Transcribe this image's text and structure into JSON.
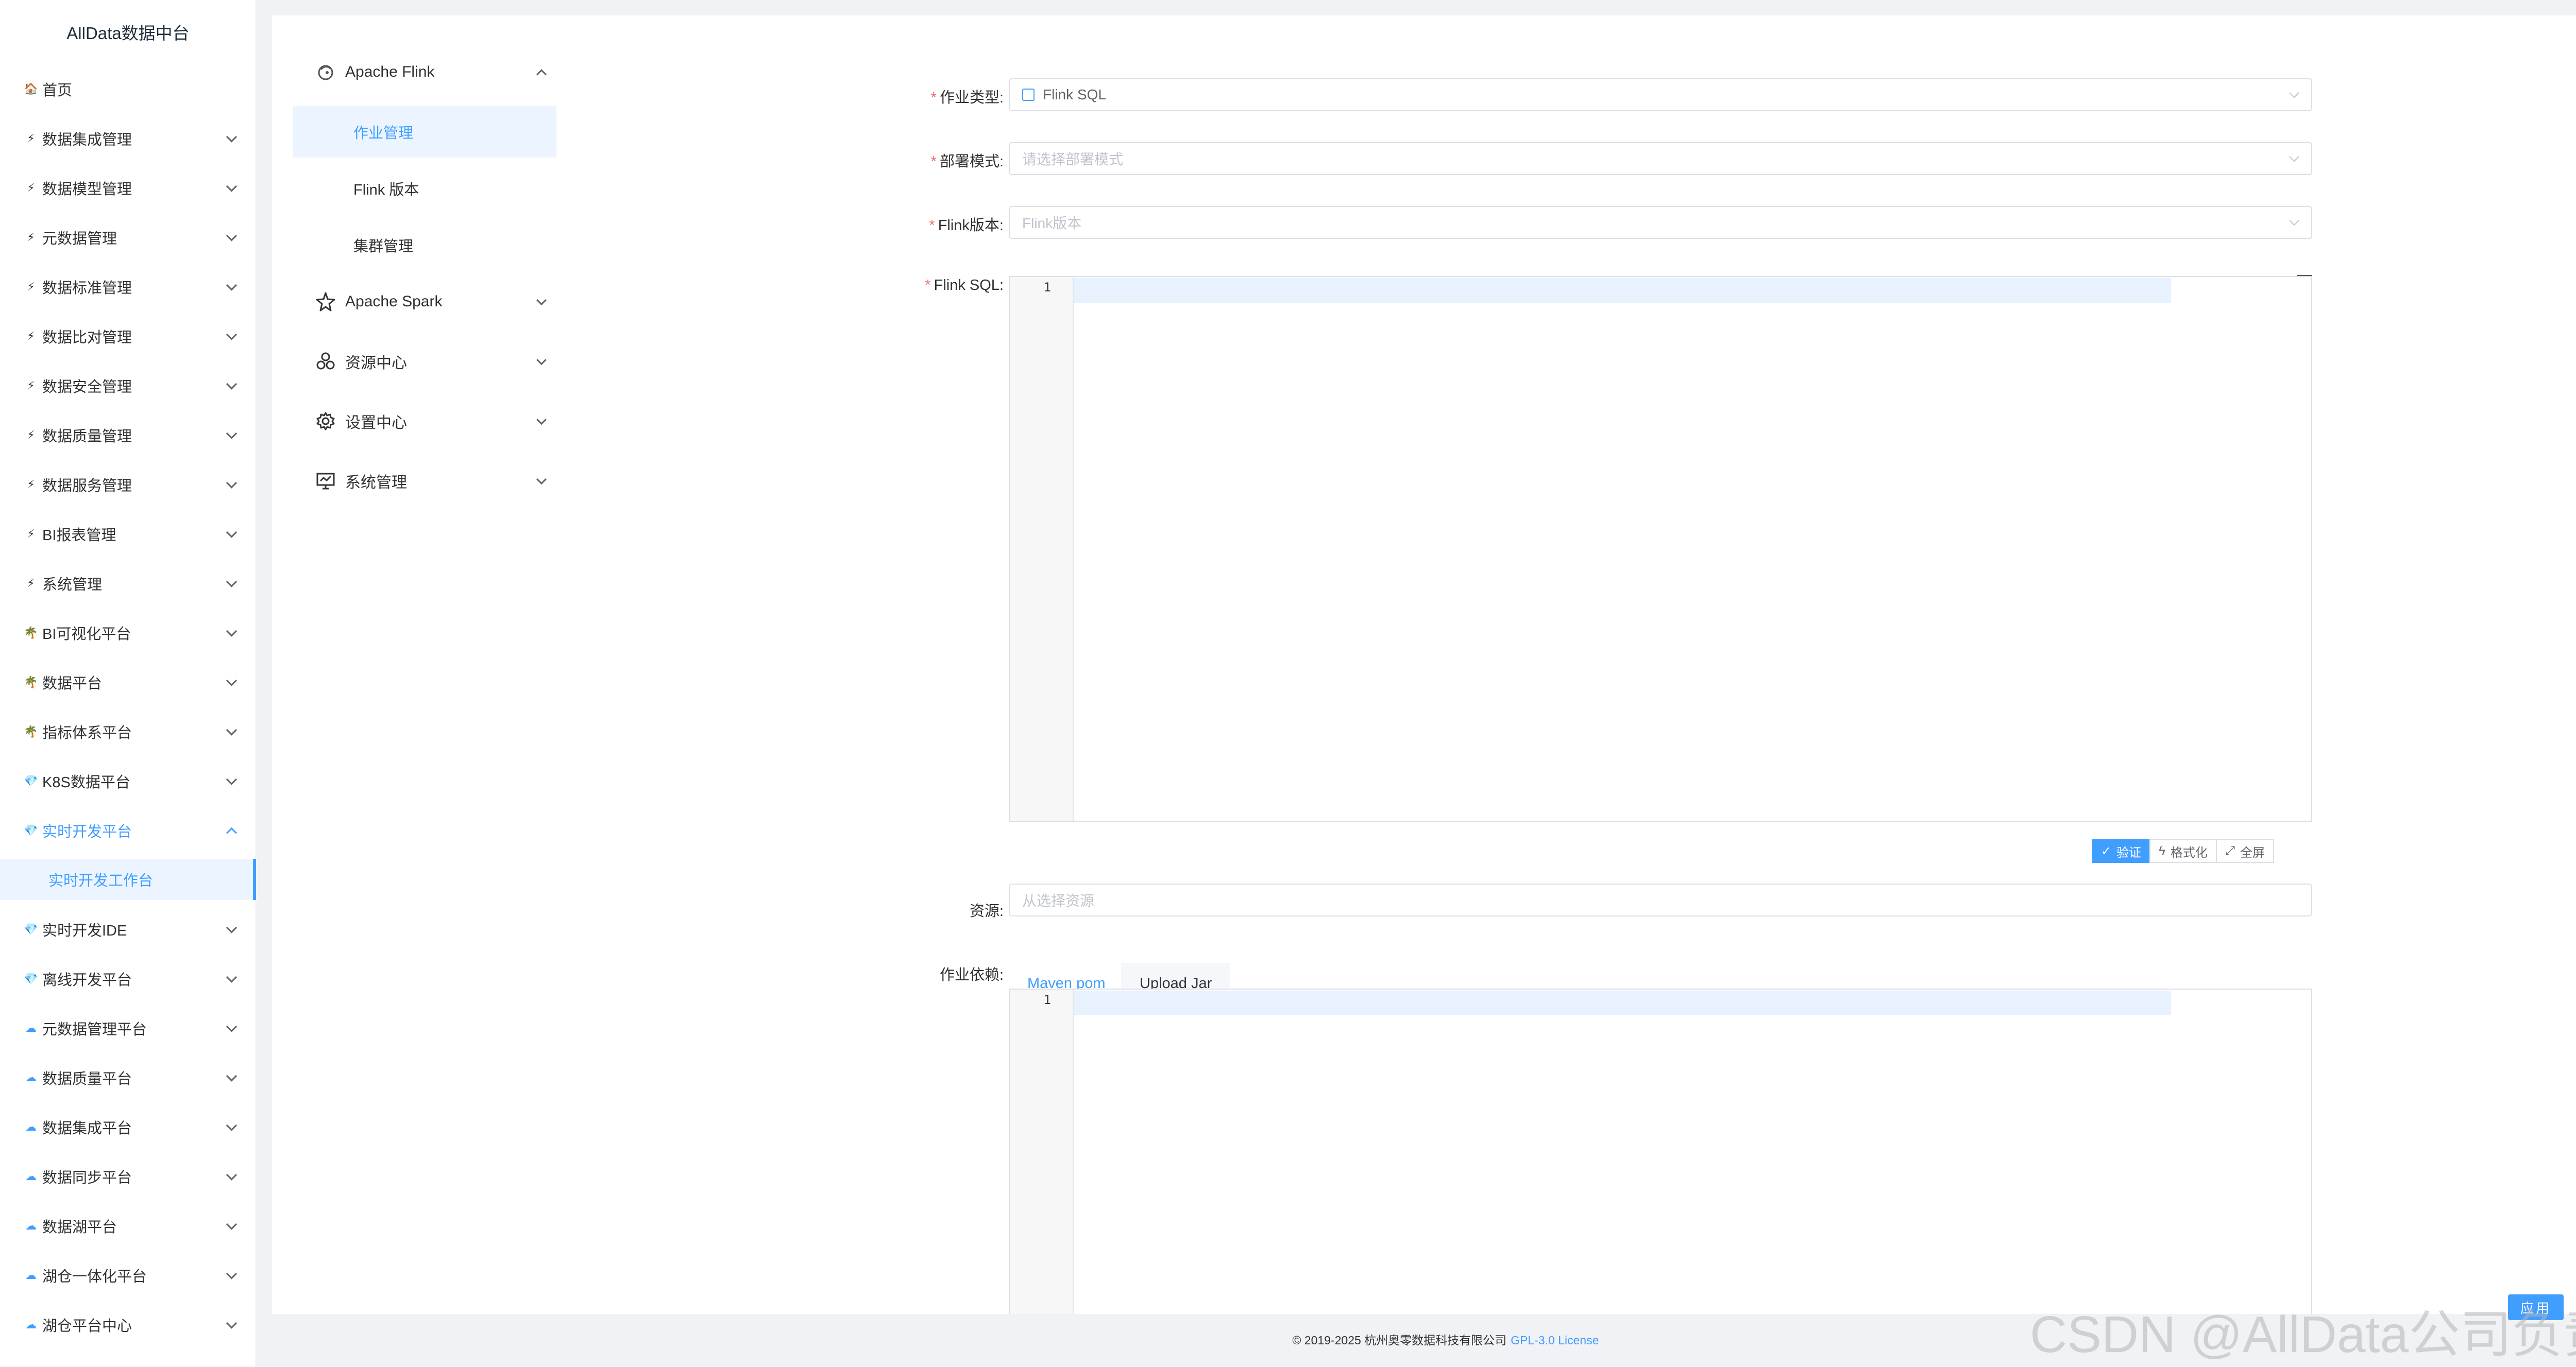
{
  "app": {
    "title": "AllData数据中台"
  },
  "sidebar": {
    "items": [
      {
        "label": "首页",
        "icon": "home-icon",
        "glyph": "🏠"
      },
      {
        "label": "数据集成管理",
        "icon": "lightning-icon",
        "glyph": "⚡"
      },
      {
        "label": "数据模型管理",
        "icon": "lightning-icon",
        "glyph": "⚡"
      },
      {
        "label": "元数据管理",
        "icon": "lightning-icon",
        "glyph": "⚡"
      },
      {
        "label": "数据标准管理",
        "icon": "lightning-icon",
        "glyph": "⚡"
      },
      {
        "label": "数据比对管理",
        "icon": "lightning-icon",
        "glyph": "⚡"
      },
      {
        "label": "数据安全管理",
        "icon": "lightning-icon",
        "glyph": "⚡"
      },
      {
        "label": "数据质量管理",
        "icon": "lightning-icon",
        "glyph": "⚡"
      },
      {
        "label": "数据服务管理",
        "icon": "lightning-icon",
        "glyph": "⚡"
      },
      {
        "label": "BI报表管理",
        "icon": "lightning-icon",
        "glyph": "⚡"
      },
      {
        "label": "系统管理",
        "icon": "lightning-icon",
        "glyph": "⚡"
      },
      {
        "label": "BI可视化平台",
        "icon": "palm-tree-icon",
        "glyph": "🌴"
      },
      {
        "label": "数据平台",
        "icon": "palm-tree-icon",
        "glyph": "🌴"
      },
      {
        "label": "指标体系平台",
        "icon": "palm-tree-icon",
        "glyph": "🌴"
      },
      {
        "label": "K8S数据平台",
        "icon": "diamond-icon",
        "glyph": "💎"
      },
      {
        "label": "实时开发平台",
        "icon": "diamond-icon",
        "glyph": "💎",
        "open": true
      },
      {
        "label": "实时开发IDE",
        "icon": "diamond-icon",
        "glyph": "💎"
      },
      {
        "label": "离线开发平台",
        "icon": "diamond-icon",
        "glyph": "💎"
      },
      {
        "label": "元数据管理平台",
        "icon": "cloud-icon",
        "glyph": "☁"
      },
      {
        "label": "数据质量平台",
        "icon": "cloud-icon",
        "glyph": "☁"
      },
      {
        "label": "数据集成平台",
        "icon": "cloud-icon",
        "glyph": "☁"
      },
      {
        "label": "数据同步平台",
        "icon": "cloud-icon",
        "glyph": "☁"
      },
      {
        "label": "数据湖平台",
        "icon": "cloud-icon",
        "glyph": "☁"
      },
      {
        "label": "湖仓一体化平台",
        "icon": "cloud-icon",
        "glyph": "☁"
      },
      {
        "label": "湖仓平台中心",
        "icon": "cloud-icon",
        "glyph": "☁"
      }
    ],
    "active_sub": "实时开发工作台"
  },
  "submenu": {
    "flink": {
      "label": "Apache Flink",
      "icon": "flink-squirrel-icon"
    },
    "flink_children": [
      "作业管理",
      "Flink 版本",
      "集群管理"
    ],
    "spark": {
      "label": "Apache Spark",
      "icon": "spark-star-icon"
    },
    "resource": {
      "label": "资源中心",
      "icon": "resource-cluster-icon"
    },
    "settings": {
      "label": "设置中心",
      "icon": "gear-icon"
    },
    "system": {
      "label": "系统管理",
      "icon": "monitor-icon"
    }
  },
  "form": {
    "job_type": {
      "label": "作业类型:",
      "value": "Flink SQL"
    },
    "deploy_mode": {
      "label": "部署模式:",
      "placeholder": "请选择部署模式"
    },
    "flink_version": {
      "label": "Flink版本:",
      "placeholder": "Flink版本"
    },
    "flink_sql": {
      "label": "Flink SQL:",
      "line": "1"
    },
    "actions": {
      "verify": "验证",
      "format": "格式化",
      "fullscreen": "全屏"
    },
    "resource": {
      "label": "资源:",
      "placeholder": "从选择资源"
    },
    "dependency": {
      "label": "作业依赖:",
      "tabs": [
        "Maven pom",
        "Upload Jar"
      ],
      "line": "1",
      "apply": "应用"
    }
  },
  "footer": {
    "copyright": "© 2019-2025 杭州奥零数据科技有限公司",
    "license": "GPL-3.0 License"
  },
  "watermark": "CSDN @AllData公司负责人",
  "colors": {
    "accent": "#409eff",
    "required": "#f56c6c",
    "active_bg": "#ecf5ff"
  }
}
